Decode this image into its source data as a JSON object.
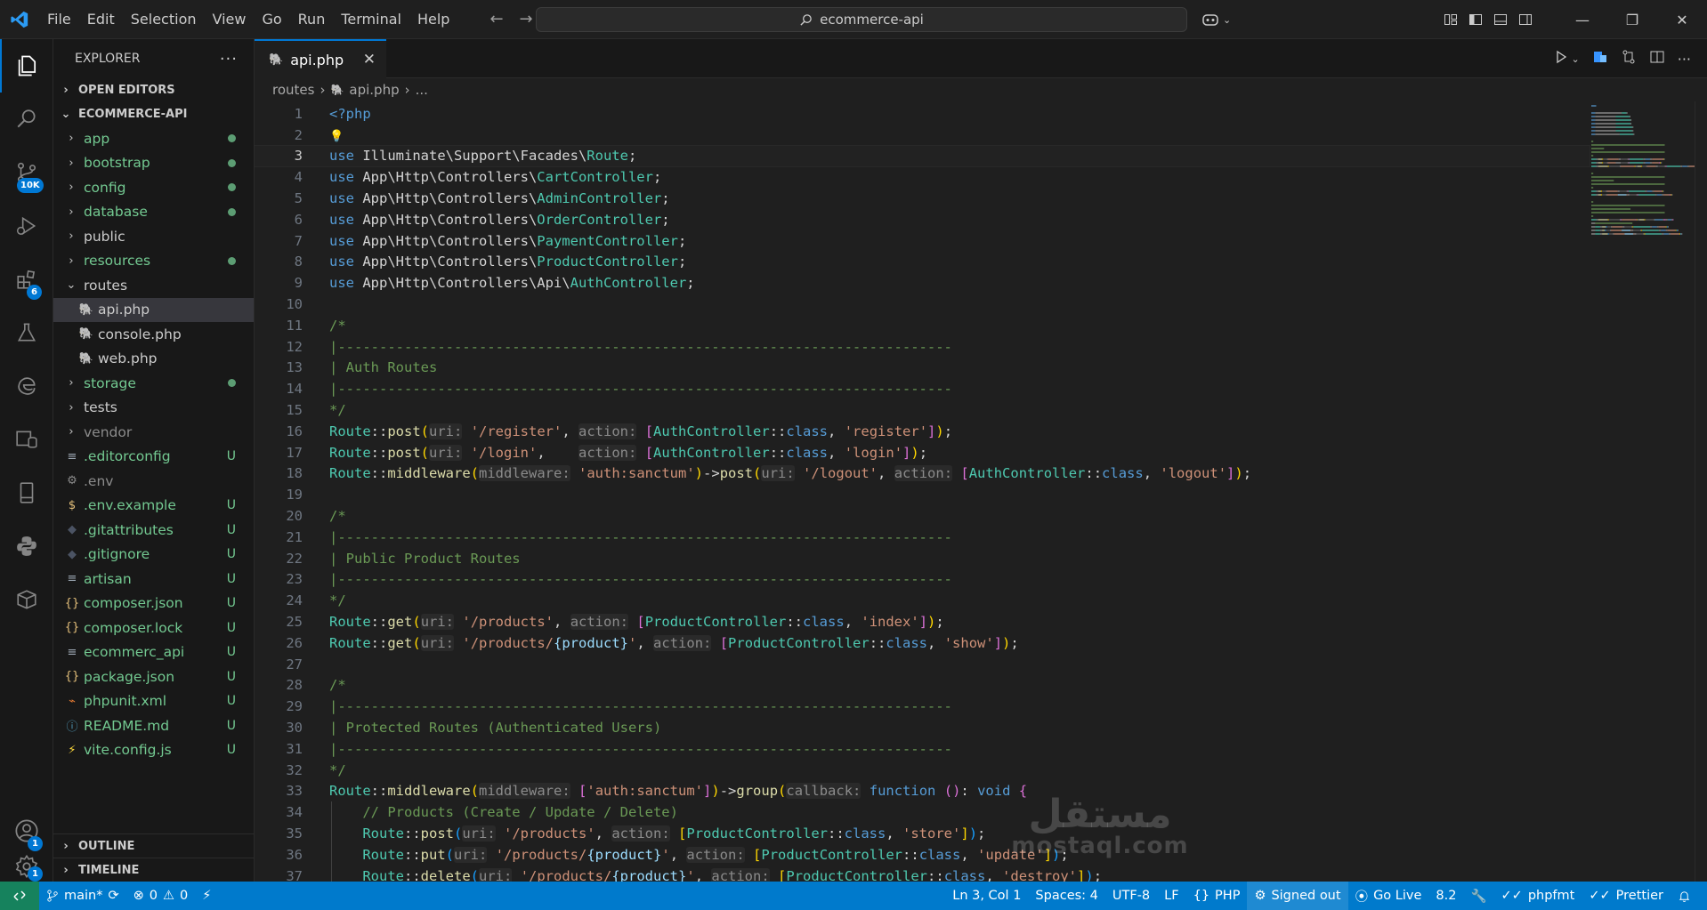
{
  "menu": [
    "File",
    "Edit",
    "Selection",
    "View",
    "Go",
    "Run",
    "Terminal",
    "Help"
  ],
  "command_center": "ecommerce-api",
  "activity": {
    "source_control_badge": "10K",
    "extensions_badge": "6",
    "accounts_badge": "1",
    "settings_badge": "1"
  },
  "sidebar": {
    "title": "EXPLORER",
    "open_editors": "OPEN EDITORS",
    "project": "ECOMMERCE-API",
    "items": [
      {
        "label": "app",
        "type": "folder",
        "open": false,
        "dot": true
      },
      {
        "label": "bootstrap",
        "type": "folder",
        "open": false,
        "dot": true
      },
      {
        "label": "config",
        "type": "folder",
        "open": false,
        "dot": true
      },
      {
        "label": "database",
        "type": "folder",
        "open": false,
        "dot": true
      },
      {
        "label": "public",
        "type": "folder",
        "open": false,
        "dot": false
      },
      {
        "label": "resources",
        "type": "folder",
        "open": false,
        "dot": true
      },
      {
        "label": "routes",
        "type": "folder",
        "open": true,
        "dot": false
      },
      {
        "label": "api.php",
        "type": "php",
        "indent": 2,
        "selected": true
      },
      {
        "label": "console.php",
        "type": "php",
        "indent": 2
      },
      {
        "label": "web.php",
        "type": "php",
        "indent": 2
      },
      {
        "label": "storage",
        "type": "folder",
        "open": false,
        "dot": true
      },
      {
        "label": "tests",
        "type": "folder",
        "open": false,
        "dot": false
      },
      {
        "label": "vendor",
        "type": "folder",
        "open": false,
        "dot": false,
        "dim": true
      },
      {
        "label": ".editorconfig",
        "type": "lines",
        "status": "U"
      },
      {
        "label": ".env",
        "type": "gear",
        "status": "",
        "dim": true
      },
      {
        "label": ".env.example",
        "type": "dollar",
        "status": "U"
      },
      {
        "label": ".gitattributes",
        "type": "git",
        "status": "U"
      },
      {
        "label": ".gitignore",
        "type": "git",
        "status": "U"
      },
      {
        "label": "artisan",
        "type": "lines",
        "status": "U"
      },
      {
        "label": "composer.json",
        "type": "braces",
        "status": "U"
      },
      {
        "label": "composer.lock",
        "type": "braces",
        "status": "U"
      },
      {
        "label": "ecommerc_api",
        "type": "lines",
        "status": "U"
      },
      {
        "label": "package.json",
        "type": "braces",
        "status": "U"
      },
      {
        "label": "phpunit.xml",
        "type": "rss",
        "status": "U"
      },
      {
        "label": "README.md",
        "type": "info",
        "status": "U"
      },
      {
        "label": "vite.config.js",
        "type": "bolt",
        "status": "U"
      }
    ],
    "outline": "OUTLINE",
    "timeline": "TIMELINE"
  },
  "tab": {
    "label": "api.php"
  },
  "breadcrumb": {
    "folder": "routes",
    "file": "api.php",
    "more": "..."
  },
  "code_lines": [
    {
      "n": "1",
      "parts": [
        [
          "kw",
          "<?php"
        ]
      ]
    },
    {
      "n": "2",
      "parts": [],
      "bulb": true
    },
    {
      "n": "3",
      "parts": [
        [
          "kw",
          "use "
        ],
        [
          "tx",
          "Illuminate\\Support\\Facades\\"
        ],
        [
          "cl",
          "Route"
        ],
        [
          "tx",
          ";"
        ]
      ],
      "current": true
    },
    {
      "n": "4",
      "parts": [
        [
          "kw",
          "use "
        ],
        [
          "tx",
          "App\\Http\\Controllers\\"
        ],
        [
          "cl",
          "CartController"
        ],
        [
          "tx",
          ";"
        ]
      ]
    },
    {
      "n": "5",
      "parts": [
        [
          "kw",
          "use "
        ],
        [
          "tx",
          "App\\Http\\Controllers\\"
        ],
        [
          "cl",
          "AdminController"
        ],
        [
          "tx",
          ";"
        ]
      ]
    },
    {
      "n": "6",
      "parts": [
        [
          "kw",
          "use "
        ],
        [
          "tx",
          "App\\Http\\Controllers\\"
        ],
        [
          "cl",
          "OrderController"
        ],
        [
          "tx",
          ";"
        ]
      ]
    },
    {
      "n": "7",
      "parts": [
        [
          "kw",
          "use "
        ],
        [
          "tx",
          "App\\Http\\Controllers\\"
        ],
        [
          "cl",
          "PaymentController"
        ],
        [
          "tx",
          ";"
        ]
      ]
    },
    {
      "n": "8",
      "parts": [
        [
          "kw",
          "use "
        ],
        [
          "tx",
          "App\\Http\\Controllers\\"
        ],
        [
          "cl",
          "ProductController"
        ],
        [
          "tx",
          ";"
        ]
      ]
    },
    {
      "n": "9",
      "parts": [
        [
          "kw",
          "use "
        ],
        [
          "tx",
          "App\\Http\\Controllers\\Api\\"
        ],
        [
          "cl",
          "AuthController"
        ],
        [
          "tx",
          ";"
        ]
      ]
    },
    {
      "n": "10",
      "parts": []
    },
    {
      "n": "11",
      "parts": [
        [
          "cm",
          "/*"
        ]
      ]
    },
    {
      "n": "12",
      "parts": [
        [
          "cm",
          "|--------------------------------------------------------------------------"
        ]
      ]
    },
    {
      "n": "13",
      "parts": [
        [
          "cm",
          "| Auth Routes"
        ]
      ]
    },
    {
      "n": "14",
      "parts": [
        [
          "cm",
          "|--------------------------------------------------------------------------"
        ]
      ]
    },
    {
      "n": "15",
      "parts": [
        [
          "cm",
          "*/"
        ]
      ]
    },
    {
      "n": "16",
      "parts": [
        [
          "cl",
          "Route"
        ],
        [
          "tx",
          "::"
        ],
        [
          "fn",
          "post"
        ],
        [
          "br1",
          "("
        ],
        [
          "hint",
          "uri:"
        ],
        [
          "tx",
          " "
        ],
        [
          "st",
          "'/register'"
        ],
        [
          "tx",
          ", "
        ],
        [
          "hint",
          "action:"
        ],
        [
          "tx",
          " "
        ],
        [
          "br2",
          "["
        ],
        [
          "cl",
          "AuthController"
        ],
        [
          "tx",
          "::"
        ],
        [
          "kw",
          "class"
        ],
        [
          "tx",
          ", "
        ],
        [
          "st",
          "'register'"
        ],
        [
          "br2",
          "]"
        ],
        [
          "br1",
          ")"
        ],
        [
          "tx",
          ";"
        ]
      ]
    },
    {
      "n": "17",
      "parts": [
        [
          "cl",
          "Route"
        ],
        [
          "tx",
          "::"
        ],
        [
          "fn",
          "post"
        ],
        [
          "br1",
          "("
        ],
        [
          "hint",
          "uri:"
        ],
        [
          "tx",
          " "
        ],
        [
          "st",
          "'/login'"
        ],
        [
          "tx",
          ",    "
        ],
        [
          "hint",
          "action:"
        ],
        [
          "tx",
          " "
        ],
        [
          "br2",
          "["
        ],
        [
          "cl",
          "AuthController"
        ],
        [
          "tx",
          "::"
        ],
        [
          "kw",
          "class"
        ],
        [
          "tx",
          ", "
        ],
        [
          "st",
          "'login'"
        ],
        [
          "br2",
          "]"
        ],
        [
          "br1",
          ")"
        ],
        [
          "tx",
          ";"
        ]
      ]
    },
    {
      "n": "18",
      "parts": [
        [
          "cl",
          "Route"
        ],
        [
          "tx",
          "::"
        ],
        [
          "fn",
          "middleware"
        ],
        [
          "br1",
          "("
        ],
        [
          "hint",
          "middleware:"
        ],
        [
          "tx",
          " "
        ],
        [
          "st",
          "'auth:sanctum'"
        ],
        [
          "br1",
          ")"
        ],
        [
          "tx",
          "->"
        ],
        [
          "fn",
          "post"
        ],
        [
          "br1",
          "("
        ],
        [
          "hint",
          "uri:"
        ],
        [
          "tx",
          " "
        ],
        [
          "st",
          "'/logout'"
        ],
        [
          "tx",
          ", "
        ],
        [
          "hint",
          "action:"
        ],
        [
          "tx",
          " "
        ],
        [
          "br2",
          "["
        ],
        [
          "cl",
          "AuthController"
        ],
        [
          "tx",
          "::"
        ],
        [
          "kw",
          "class"
        ],
        [
          "tx",
          ", "
        ],
        [
          "st",
          "'logout'"
        ],
        [
          "br2",
          "]"
        ],
        [
          "br1",
          ")"
        ],
        [
          "tx",
          ";"
        ]
      ]
    },
    {
      "n": "19",
      "parts": []
    },
    {
      "n": "20",
      "parts": [
        [
          "cm",
          "/*"
        ]
      ]
    },
    {
      "n": "21",
      "parts": [
        [
          "cm",
          "|--------------------------------------------------------------------------"
        ]
      ]
    },
    {
      "n": "22",
      "parts": [
        [
          "cm",
          "| Public Product Routes"
        ]
      ]
    },
    {
      "n": "23",
      "parts": [
        [
          "cm",
          "|--------------------------------------------------------------------------"
        ]
      ]
    },
    {
      "n": "24",
      "parts": [
        [
          "cm",
          "*/"
        ]
      ]
    },
    {
      "n": "25",
      "parts": [
        [
          "cl",
          "Route"
        ],
        [
          "tx",
          "::"
        ],
        [
          "fn",
          "get"
        ],
        [
          "br1",
          "("
        ],
        [
          "hint",
          "uri:"
        ],
        [
          "tx",
          " "
        ],
        [
          "st",
          "'/products'"
        ],
        [
          "tx",
          ", "
        ],
        [
          "hint",
          "action:"
        ],
        [
          "tx",
          " "
        ],
        [
          "br2",
          "["
        ],
        [
          "cl",
          "ProductController"
        ],
        [
          "tx",
          "::"
        ],
        [
          "kw",
          "class"
        ],
        [
          "tx",
          ", "
        ],
        [
          "st",
          "'index'"
        ],
        [
          "br2",
          "]"
        ],
        [
          "br1",
          ")"
        ],
        [
          "tx",
          ";"
        ]
      ]
    },
    {
      "n": "26",
      "parts": [
        [
          "cl",
          "Route"
        ],
        [
          "tx",
          "::"
        ],
        [
          "fn",
          "get"
        ],
        [
          "br1",
          "("
        ],
        [
          "hint",
          "uri:"
        ],
        [
          "tx",
          " "
        ],
        [
          "st",
          "'/products/"
        ],
        [
          "vr",
          "{product}"
        ],
        [
          "st",
          "'"
        ],
        [
          "tx",
          ", "
        ],
        [
          "hint",
          "action:"
        ],
        [
          "tx",
          " "
        ],
        [
          "br2",
          "["
        ],
        [
          "cl",
          "ProductController"
        ],
        [
          "tx",
          "::"
        ],
        [
          "kw",
          "class"
        ],
        [
          "tx",
          ", "
        ],
        [
          "st",
          "'show'"
        ],
        [
          "br2",
          "]"
        ],
        [
          "br1",
          ")"
        ],
        [
          "tx",
          ";"
        ]
      ]
    },
    {
      "n": "27",
      "parts": []
    },
    {
      "n": "28",
      "parts": [
        [
          "cm",
          "/*"
        ]
      ]
    },
    {
      "n": "29",
      "parts": [
        [
          "cm",
          "|--------------------------------------------------------------------------"
        ]
      ]
    },
    {
      "n": "30",
      "parts": [
        [
          "cm",
          "| Protected Routes (Authenticated Users)"
        ]
      ]
    },
    {
      "n": "31",
      "parts": [
        [
          "cm",
          "|--------------------------------------------------------------------------"
        ]
      ]
    },
    {
      "n": "32",
      "parts": [
        [
          "cm",
          "*/"
        ]
      ]
    },
    {
      "n": "33",
      "parts": [
        [
          "cl",
          "Route"
        ],
        [
          "tx",
          "::"
        ],
        [
          "fn",
          "middleware"
        ],
        [
          "br1",
          "("
        ],
        [
          "hint",
          "middleware:"
        ],
        [
          "tx",
          " "
        ],
        [
          "br2",
          "["
        ],
        [
          "st",
          "'auth:sanctum'"
        ],
        [
          "br2",
          "]"
        ],
        [
          "br1",
          ")"
        ],
        [
          "tx",
          "->"
        ],
        [
          "fn",
          "group"
        ],
        [
          "br1",
          "("
        ],
        [
          "hint",
          "callback:"
        ],
        [
          "tx",
          " "
        ],
        [
          "kw",
          "function"
        ],
        [
          "tx",
          " "
        ],
        [
          "br2",
          "("
        ],
        [
          "br2",
          ")"
        ],
        [
          "tx",
          ": "
        ],
        [
          "kw",
          "void"
        ],
        [
          "tx",
          " "
        ],
        [
          "br2",
          "{"
        ]
      ]
    },
    {
      "n": "34",
      "parts": [
        [
          "tx",
          "    "
        ],
        [
          "cm",
          "// Products (Create / Update / Delete)"
        ]
      ]
    },
    {
      "n": "35",
      "parts": [
        [
          "tx",
          "    "
        ],
        [
          "cl",
          "Route"
        ],
        [
          "tx",
          "::"
        ],
        [
          "fn",
          "post"
        ],
        [
          "br3",
          "("
        ],
        [
          "hint",
          "uri:"
        ],
        [
          "tx",
          " "
        ],
        [
          "st",
          "'/products'"
        ],
        [
          "tx",
          ", "
        ],
        [
          "hint",
          "action:"
        ],
        [
          "tx",
          " "
        ],
        [
          "br1",
          "["
        ],
        [
          "cl",
          "ProductController"
        ],
        [
          "tx",
          "::"
        ],
        [
          "kw",
          "class"
        ],
        [
          "tx",
          ", "
        ],
        [
          "st",
          "'store'"
        ],
        [
          "br1",
          "]"
        ],
        [
          "br3",
          ")"
        ],
        [
          "tx",
          ";"
        ]
      ]
    },
    {
      "n": "36",
      "parts": [
        [
          "tx",
          "    "
        ],
        [
          "cl",
          "Route"
        ],
        [
          "tx",
          "::"
        ],
        [
          "fn",
          "put"
        ],
        [
          "br3",
          "("
        ],
        [
          "hint",
          "uri:"
        ],
        [
          "tx",
          " "
        ],
        [
          "st",
          "'/products/"
        ],
        [
          "vr",
          "{product}"
        ],
        [
          "st",
          "'"
        ],
        [
          "tx",
          ", "
        ],
        [
          "hint",
          "action:"
        ],
        [
          "tx",
          " "
        ],
        [
          "br1",
          "["
        ],
        [
          "cl",
          "ProductController"
        ],
        [
          "tx",
          "::"
        ],
        [
          "kw",
          "class"
        ],
        [
          "tx",
          ", "
        ],
        [
          "st",
          "'update'"
        ],
        [
          "br1",
          "]"
        ],
        [
          "br3",
          ")"
        ],
        [
          "tx",
          ";"
        ]
      ]
    },
    {
      "n": "37",
      "parts": [
        [
          "tx",
          "    "
        ],
        [
          "cl",
          "Route"
        ],
        [
          "tx",
          "::"
        ],
        [
          "fn",
          "delete"
        ],
        [
          "br3",
          "("
        ],
        [
          "hint",
          "uri:"
        ],
        [
          "tx",
          " "
        ],
        [
          "st",
          "'/products/"
        ],
        [
          "vr",
          "{product}"
        ],
        [
          "st",
          "'"
        ],
        [
          "tx",
          ", "
        ],
        [
          "hint",
          "action:"
        ],
        [
          "tx",
          " "
        ],
        [
          "br1",
          "["
        ],
        [
          "cl",
          "ProductController"
        ],
        [
          "tx",
          "::"
        ],
        [
          "kw",
          "class"
        ],
        [
          "tx",
          ", "
        ],
        [
          "st",
          "'destroy'"
        ],
        [
          "br1",
          "]"
        ],
        [
          "br3",
          ")"
        ],
        [
          "tx",
          ";"
        ]
      ]
    }
  ],
  "watermark": {
    "arabic": "مستقل",
    "latin": "mostaql.com"
  },
  "status": {
    "branch": "main*",
    "errors": "0",
    "warnings": "0",
    "position": "Ln 3, Col 1",
    "spaces": "Spaces: 4",
    "encoding": "UTF-8",
    "eol": "LF",
    "language": "PHP",
    "account": "Signed out",
    "golive": "Go Live",
    "php_version": "8.2",
    "phpfmt": "phpfmt",
    "prettier": "Prettier"
  }
}
